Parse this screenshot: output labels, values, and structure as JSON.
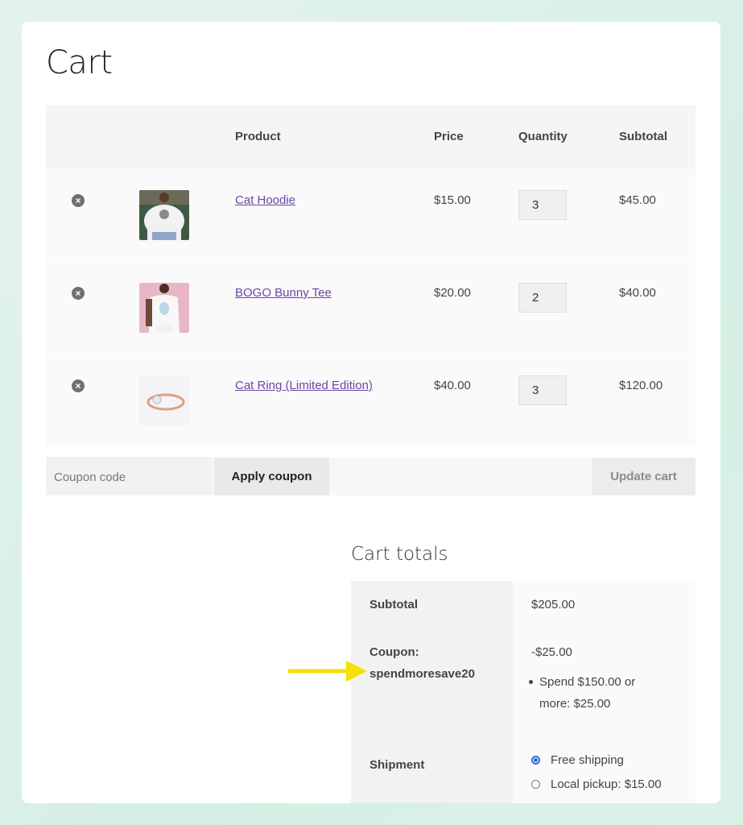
{
  "page": {
    "title": "Cart"
  },
  "table": {
    "headers": {
      "product": "Product",
      "price": "Price",
      "quantity": "Quantity",
      "subtotal": "Subtotal"
    },
    "items": [
      {
        "name": "Cat Hoodie",
        "price": "$15.00",
        "quantity": "3",
        "subtotal": "$45.00"
      },
      {
        "name": "BOGO Bunny Tee",
        "price": "$20.00",
        "quantity": "2",
        "subtotal": "$40.00"
      },
      {
        "name": "Cat Ring (Limited Edition)",
        "price": "$40.00",
        "quantity": "3",
        "subtotal": "$120.00"
      }
    ],
    "remove_icon": "close-circle-icon"
  },
  "actions": {
    "coupon_placeholder": "Coupon code",
    "apply_label": "Apply coupon",
    "update_label": "Update cart"
  },
  "totals": {
    "title": "Cart totals",
    "subtotal_label": "Subtotal",
    "subtotal_value": "$205.00",
    "coupon_label": "Coupon:",
    "coupon_code": "spendmoresave20",
    "coupon_value": "-$25.00",
    "coupon_note": "Spend $150.00 or more: $25.00",
    "shipment_label": "Shipment",
    "shipping_options": [
      {
        "label": "Free shipping",
        "selected": true
      },
      {
        "label": "Local pickup: $15.00",
        "selected": false
      }
    ]
  },
  "colors": {
    "link": "#6b46a6",
    "annotation_arrow": "#f5e000",
    "radio_selected": "#2b6fd6"
  }
}
